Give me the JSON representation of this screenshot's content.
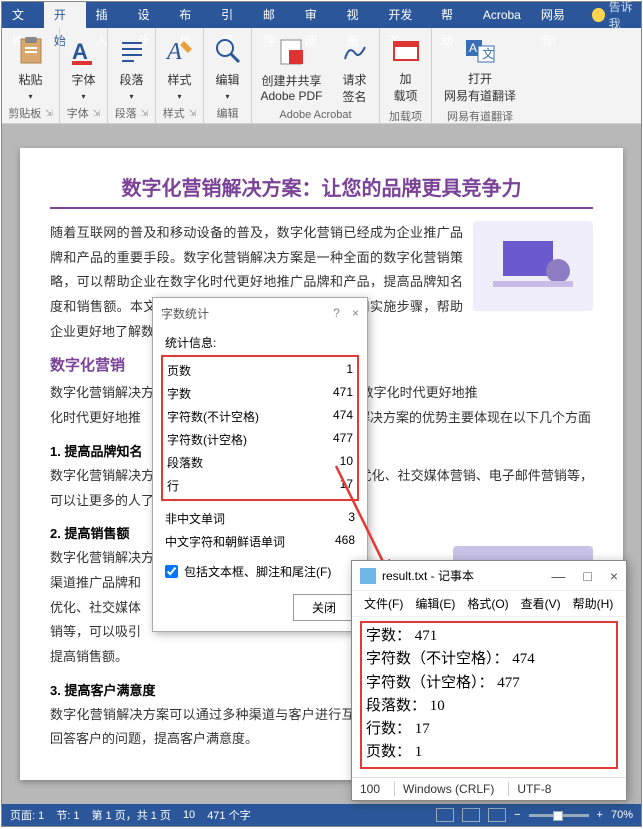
{
  "tabs": {
    "file": "文件",
    "home": "开始",
    "insert": "插入",
    "design": "设计",
    "layout": "布局",
    "references": "引用",
    "mail": "邮件",
    "review": "审阅",
    "view": "视图",
    "dev": "开发工",
    "help": "帮助",
    "acrobat": "Acroba",
    "netease": "网易有i",
    "tell": "告诉我"
  },
  "ribbon": {
    "clipboard": {
      "label": "剪贴板",
      "paste": "粘贴"
    },
    "font": {
      "label": "字体",
      "btn": "字体"
    },
    "paragraph": {
      "label": "段落",
      "btn": "段落"
    },
    "styles": {
      "label": "样式",
      "btn": "样式"
    },
    "editing": {
      "label": "编辑",
      "btn": "编辑"
    },
    "acrobat": {
      "label": "Adobe Acrobat",
      "create": "创建并共享\nAdobe PDF",
      "sign": "请求\n签名"
    },
    "addin": {
      "label": "加载项",
      "btn": "加\n载项"
    },
    "netease": {
      "label": "网易有道翻译",
      "open": "打开\n网易有道翻译"
    }
  },
  "doc": {
    "title": "数字化营销解决方案：让您的品牌更具竞争力",
    "p1": "随着互联网的普及和移动设备的普及，数字化营销已经成为企业推广品牌和产品的重要手段。数字化营销解决方案是一种全面的数字化营销策略，可以帮助企业在数字化时代更好地推广品牌和产品，提高品牌知名度和销售额。本文将介绍数字化营销解决方案的优势和实施步骤，帮助企业更好地了解数字化营销",
    "h2": "数字化营销",
    "p2a": "数字化营销解决方",
    "p2b": "业在数字化时代更好地推",
    "p2c": "化营销解决方案的优势主要体现在以下几个方面",
    "h3a": "1. 提高品牌知名",
    "p3": "数字化营销解决方",
    "p3b": "引擎优化、社交媒体营销、电子邮件营销等，可以让更多的人了解",
    "h3b": "2. 提高销售额",
    "p4": "数字化营销解决方",
    "p4b": "渠道推广品牌和",
    "p4c": "优化、社交媒体",
    "p4d": "销等，可以吸引",
    "p4e": "提高销售额。",
    "h3c": "3. 提高客户满意度",
    "p5": "数字化营销解决方案可以通过多种渠道与客户进行互动，如社交媒体、在线客服等，可以及时回答客户的问题，提高客户满意度。"
  },
  "dialog": {
    "title": "字数统计",
    "help": "?",
    "close_x": "×",
    "stats_label": "统计信息:",
    "rows": {
      "pages": {
        "label": "页数",
        "value": "1"
      },
      "words": {
        "label": "字数",
        "value": "471"
      },
      "chars_nospace": {
        "label": "字符数(不计空格)",
        "value": "474"
      },
      "chars_space": {
        "label": "字符数(计空格)",
        "value": "477"
      },
      "paragraphs": {
        "label": "段落数",
        "value": "10"
      },
      "lines": {
        "label": "行",
        "value": "17"
      }
    },
    "extra": {
      "noncjk": {
        "label": "非中文单词",
        "value": "3"
      },
      "cjk": {
        "label": "中文字符和朝鲜语单词",
        "value": "468"
      }
    },
    "checkbox": "包括文本框、脚注和尾注(F)",
    "close_btn": "关闭"
  },
  "notepad": {
    "title": "result.txt - 记事本",
    "minimize": "—",
    "maximize": "□",
    "close": "×",
    "menu": {
      "file": "文件(F)",
      "edit": "编辑(E)",
      "format": "格式(O)",
      "view": "查看(V)",
      "help": "帮助(H)"
    },
    "lines": {
      "words": "字数： 471",
      "chars_nospace": "字符数（不计空格）： 474",
      "chars_space": "字符数（计空格）： 477",
      "paragraphs": "段落数： 10",
      "lines": "行数： 17",
      "pages": "页数： 1"
    },
    "status": {
      "pos": "100",
      "eol": "Windows (CRLF)",
      "enc": "UTF-8"
    }
  },
  "statusbar": {
    "page": "页面: 1",
    "sec": "节: 1",
    "page_of": "第 1 页，共 1 页",
    "loc": "10",
    "words": "471 个字",
    "zoom": "70%"
  }
}
